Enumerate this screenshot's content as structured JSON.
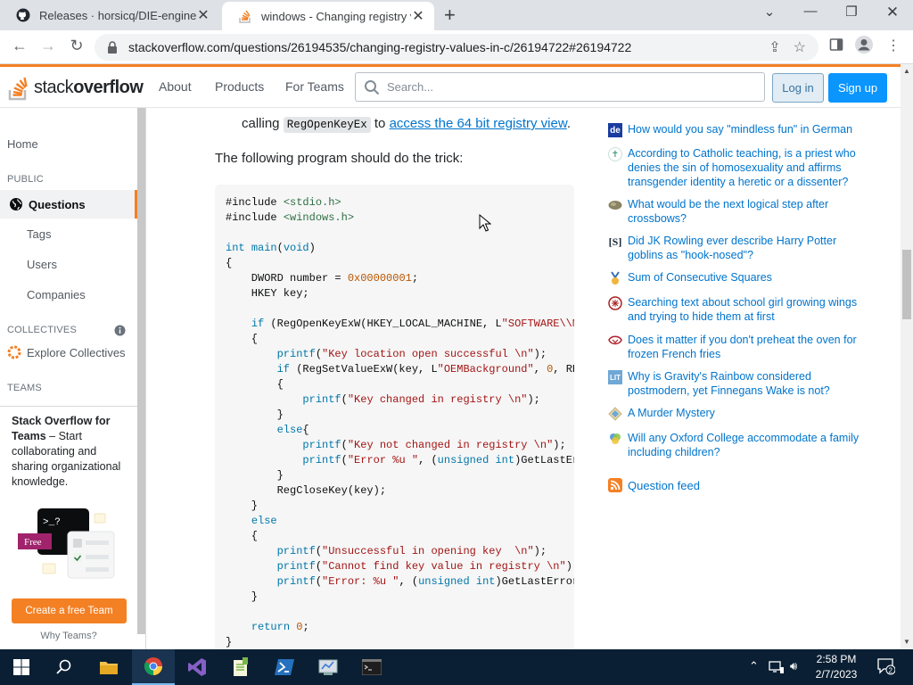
{
  "browser": {
    "tabs": [
      {
        "title": "Releases · horsicq/DIE-engine",
        "icon": "github-icon"
      },
      {
        "title": "windows - Changing registry valu",
        "icon": "stackoverflow-icon"
      }
    ],
    "url": "stackoverflow.com/questions/26194535/changing-registry-values-in-c/26194722#26194722"
  },
  "header": {
    "logo_plain": "stack",
    "logo_bold": "overflow",
    "nav": [
      "About",
      "Products",
      "For Teams"
    ],
    "search_placeholder": "Search...",
    "login": "Log in",
    "signup": "Sign up"
  },
  "sidebar": {
    "home": "Home",
    "public_heading": "PUBLIC",
    "questions": "Questions",
    "tags": "Tags",
    "users": "Users",
    "companies": "Companies",
    "collectives_heading": "COLLECTIVES",
    "explore_collectives": "Explore Collectives",
    "teams_heading": "TEAMS",
    "teams_title": "Stack Overflow for Teams",
    "teams_desc": " – Start collaborating and sharing organizational knowledge.",
    "free_badge": "Free",
    "create_team": "Create a free Team",
    "why_teams": "Why Teams?"
  },
  "answer": {
    "line1_pre": "calling",
    "line1_code": "RegOpenKeyEx",
    "line1_mid": "to",
    "line1_link": "access the 64 bit registry view",
    "line1_post": ".",
    "intro": "The following program should do the trick:"
  },
  "hot_questions": [
    {
      "text": "How would you say \"mindless fun\" in German",
      "icon": "german-language-site-icon"
    },
    {
      "text": "According to Catholic teaching, is a priest who denies the sin of homosexuality and affirms transgender identity a heretic or a dissenter?",
      "icon": "christianity-site-icon"
    },
    {
      "text": "What would be the next logical step after crossbows?",
      "icon": "worldbuilding-site-icon"
    },
    {
      "text": "Did JK Rowling ever describe Harry Potter goblins as \"hook-nosed\"?",
      "icon": "scifi-site-icon"
    },
    {
      "text": "Sum of Consecutive Squares",
      "icon": "puzzling-site-icon"
    },
    {
      "text": "Searching text about school girl growing wings and trying to hide them at first",
      "icon": "literature-site-icon"
    },
    {
      "text": "Does it matter if you don't preheat the oven for frozen French fries",
      "icon": "cooking-site-icon"
    },
    {
      "text": "Why is Gravity's Rainbow considered postmodern, yet Finnegans Wake is not?",
      "icon": "literature-lit-site-icon"
    },
    {
      "text": "A Murder Mystery",
      "icon": "puzzling-diamond-site-icon"
    },
    {
      "text": "Will any Oxford College accommodate a family including children?",
      "icon": "academia-site-icon"
    }
  ],
  "question_feed": "Question feed",
  "taskbar": {
    "time": "2:58 PM",
    "date": "2/7/2023",
    "notifications": "2"
  },
  "colors": {
    "accent_orange": "#f48024",
    "link_blue": "#0074cc",
    "signup_blue": "#0a95ff",
    "taskbar": "#0a1f33"
  }
}
